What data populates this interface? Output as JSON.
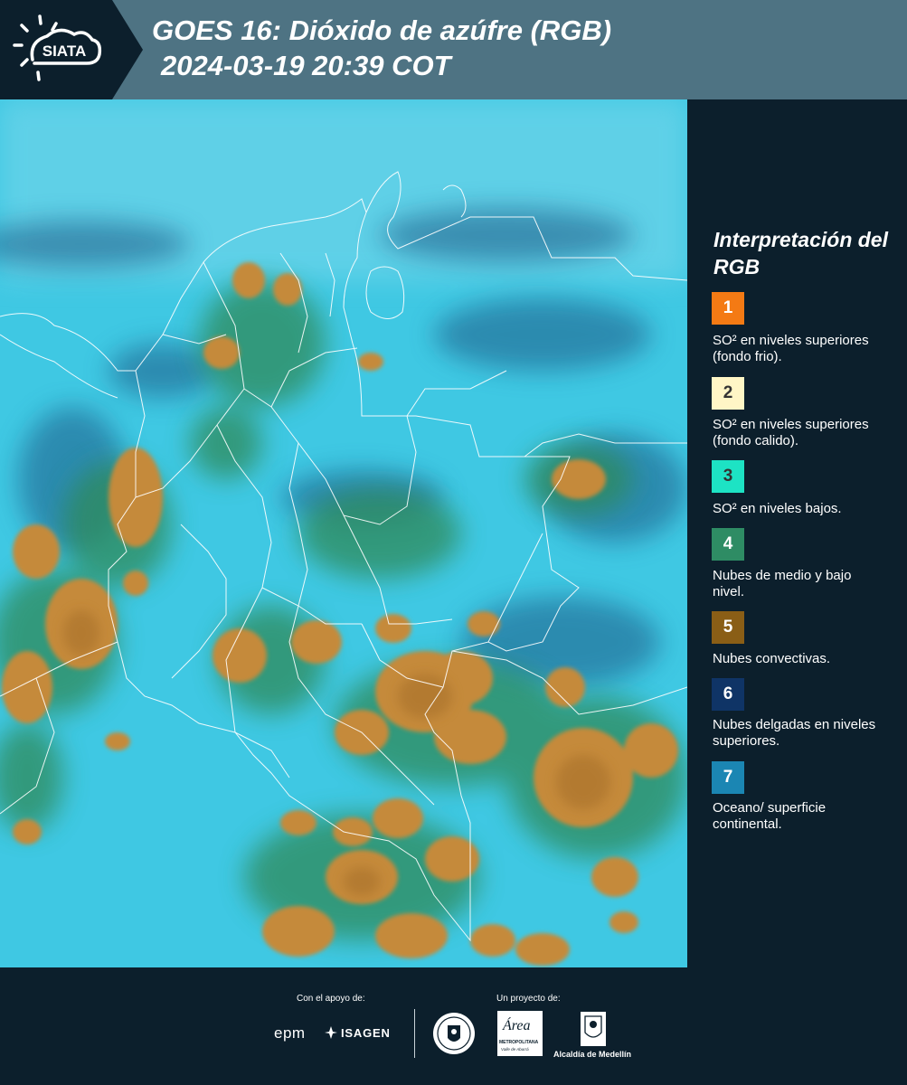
{
  "header": {
    "logo_text": "SIATA",
    "title_line1": "GOES 16: Dióxido de azúfre (RGB)",
    "title_line2": "2024-03-19 20:39 COT",
    "background_color": "#4e7383"
  },
  "map": {
    "product": "SO2 RGB composite",
    "colors": {
      "surface": "#3fc8e3",
      "convective": "#c58a3a",
      "mid_low_cloud": "#2d8a5a",
      "thin_high_cloud": "#1d4f78",
      "borders": "#ffffff"
    }
  },
  "legend": {
    "title": "Interpretación del RGB",
    "items": [
      {
        "number": "1",
        "color": "#f47a14",
        "text_color": "#ffffff",
        "label": "SO² en niveles superiores (fondo frio)."
      },
      {
        "number": "2",
        "color": "#fff6c6",
        "text_color": "#333333",
        "label": "SO² en niveles superiores (fondo calido)."
      },
      {
        "number": "3",
        "color": "#1de3c4",
        "text_color": "#333333",
        "label": "SO² en niveles bajos."
      },
      {
        "number": "4",
        "color": "#2e8c64",
        "text_color": "#ffffff",
        "label": "Nubes de medio y bajo nivel."
      },
      {
        "number": "5",
        "color": "#8a5e16",
        "text_color": "#ffffff",
        "label": "Nubes convectivas."
      },
      {
        "number": "6",
        "color": "#0f3466",
        "text_color": "#ffffff",
        "label": "Nubes delgadas en niveles superiores."
      },
      {
        "number": "7",
        "color": "#1b86b3",
        "text_color": "#ffffff",
        "label": "Oceano/ superficie continental."
      }
    ]
  },
  "footer": {
    "support_caption": "Con el apoyo de:",
    "project_caption": "Un proyecto de:",
    "sponsors": {
      "epm": "epm",
      "isagen": "ISAGEN",
      "area_metropolitana": "Área",
      "area_sub": "METROPOLITANA",
      "area_sub2": "Valle de Aburrá",
      "alcaldia": "Alcaldía de Medellín"
    }
  }
}
